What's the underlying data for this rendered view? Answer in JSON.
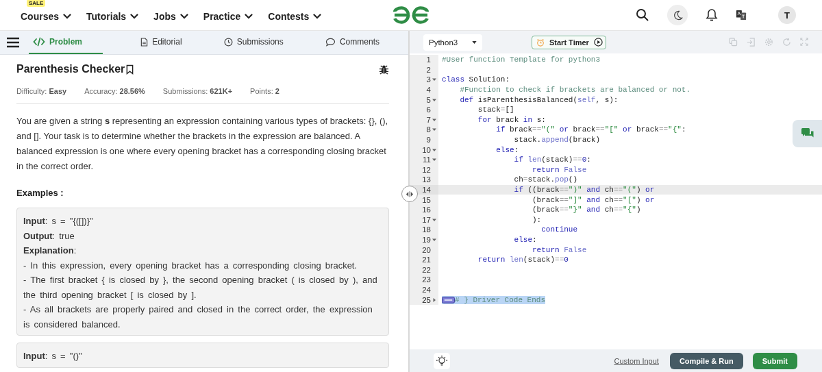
{
  "header": {
    "nav": [
      {
        "label": "Courses",
        "badge": "SALE"
      },
      {
        "label": "Tutorials"
      },
      {
        "label": "Jobs"
      },
      {
        "label": "Practice"
      },
      {
        "label": "Contests"
      }
    ],
    "avatar": "T"
  },
  "problem_tabs": [
    {
      "label": "Problem",
      "selected": true
    },
    {
      "label": "Editorial",
      "selected": false
    },
    {
      "label": "Submissions",
      "selected": false
    },
    {
      "label": "Comments",
      "selected": false
    }
  ],
  "problem": {
    "title": "Parenthesis Checker",
    "meta": [
      {
        "label": "Difficulty:",
        "value": "Easy"
      },
      {
        "label": "Accuracy:",
        "value": "28.56%"
      },
      {
        "label": "Submissions:",
        "value": "621K+"
      },
      {
        "label": "Points:",
        "value": "2"
      }
    ],
    "description": "You are given a string **s** representing an expression containing various types of brackets: {}, (), and []. Your task is to determine whether the brackets in the expression are balanced. A balanced expression is one where every opening bracket has a corresponding closing bracket in the correct order.",
    "examples_heading": "Examples :",
    "examples": [
      {
        "lines": [
          "**Input**: s = \"{([])}\"",
          "**Output**: true",
          "**Explanation**:",
          "- In this expression, every opening bracket has a corresponding closing bracket.",
          "- The first bracket { is closed by }, the second opening bracket ( is closed by ), and the third opening bracket [ is closed by ].",
          "- As all brackets are properly paired and closed in the correct order, the expression is considered balanced."
        ]
      },
      {
        "lines": [
          "**Input**: s = \"()\""
        ]
      }
    ]
  },
  "editor": {
    "language": "Python3",
    "timer_button": "Start Timer",
    "lines": [
      {
        "number": "1",
        "highlighted": false,
        "selected": false,
        "tokens": [
          {
            "kind": "comment",
            "text": "#User function Template for python3"
          }
        ]
      },
      {
        "number": "2",
        "highlighted": false,
        "selected": false
      },
      {
        "number": "3",
        "expanded": true,
        "highlighted": false,
        "selected": false,
        "tokens": [
          {
            "kind": "keyword",
            "text": "class"
          },
          {
            "kind": "plain",
            "text": " Solution:"
          }
        ]
      },
      {
        "number": "4",
        "highlighted": false,
        "selected": false,
        "tokens": [
          {
            "kind": "comment",
            "text": "    #Function to check if brackets are balanced or not."
          }
        ]
      },
      {
        "number": "5",
        "expanded": true,
        "highlighted": false,
        "selected": false,
        "tokens": [
          {
            "kind": "keyword",
            "text": "    def"
          },
          {
            "kind": "plain",
            "text": " isParenthesisBalanced("
          },
          {
            "kind": "builtin",
            "text": "self"
          },
          {
            "kind": "plain",
            "text": ", s):"
          }
        ]
      },
      {
        "number": "6",
        "highlighted": false,
        "selected": false,
        "tokens": [
          {
            "kind": "plain",
            "text": "        stack"
          },
          {
            "kind": "operator",
            "text": "="
          },
          {
            "kind": "plain",
            "text": "[]"
          }
        ]
      },
      {
        "number": "7",
        "expanded": true,
        "highlighted": false,
        "selected": false,
        "tokens": [
          {
            "kind": "keyword",
            "text": "        for"
          },
          {
            "kind": "plain",
            "text": " brack "
          },
          {
            "kind": "keyword",
            "text": "in"
          },
          {
            "kind": "plain",
            "text": " s:"
          }
        ]
      },
      {
        "number": "8",
        "expanded": true,
        "highlighted": false,
        "selected": false,
        "tokens": [
          {
            "kind": "keyword",
            "text": "            if"
          },
          {
            "kind": "plain",
            "text": " brack"
          },
          {
            "kind": "operator",
            "text": "=="
          },
          {
            "kind": "string",
            "text": "\"(\""
          },
          {
            "kind": "keyword",
            "text": " or"
          },
          {
            "kind": "plain",
            "text": " brack"
          },
          {
            "kind": "operator",
            "text": "=="
          },
          {
            "kind": "string",
            "text": "\"[\""
          },
          {
            "kind": "keyword",
            "text": " or"
          },
          {
            "kind": "plain",
            "text": " brack"
          },
          {
            "kind": "operator",
            "text": "=="
          },
          {
            "kind": "string",
            "text": "\"{\""
          },
          {
            "kind": "plain",
            "text": ":"
          }
        ]
      },
      {
        "number": "9",
        "highlighted": false,
        "selected": false,
        "tokens": [
          {
            "kind": "plain",
            "text": "                stack."
          },
          {
            "kind": "builtin",
            "text": "append"
          },
          {
            "kind": "plain",
            "text": "(brack)"
          }
        ]
      },
      {
        "number": "10",
        "expanded": true,
        "highlighted": false,
        "selected": false,
        "tokens": [
          {
            "kind": "keyword",
            "text": "            else"
          },
          {
            "kind": "plain",
            "text": ":"
          }
        ]
      },
      {
        "number": "11",
        "expanded": true,
        "highlighted": false,
        "selected": false,
        "tokens": [
          {
            "kind": "keyword",
            "text": "                if"
          },
          {
            "kind": "builtin",
            "text": " len"
          },
          {
            "kind": "plain",
            "text": "(stack)"
          },
          {
            "kind": "operator",
            "text": "=="
          },
          {
            "kind": "number",
            "text": "0"
          },
          {
            "kind": "plain",
            "text": ":"
          }
        ]
      },
      {
        "number": "12",
        "highlighted": false,
        "selected": false,
        "tokens": [
          {
            "kind": "keyword",
            "text": "                    return"
          },
          {
            "kind": "builtin",
            "text": " False"
          }
        ]
      },
      {
        "number": "13",
        "highlighted": false,
        "selected": false,
        "tokens": [
          {
            "kind": "plain",
            "text": "                ch"
          },
          {
            "kind": "operator",
            "text": "="
          },
          {
            "kind": "plain",
            "text": "stack."
          },
          {
            "kind": "builtin",
            "text": "pop"
          },
          {
            "kind": "plain",
            "text": "()"
          }
        ]
      },
      {
        "number": "14",
        "highlighted": true,
        "selected": false,
        "tokens": [
          {
            "kind": "keyword",
            "text": "                if"
          },
          {
            "kind": "plain",
            "text": " ((brack"
          },
          {
            "kind": "operator",
            "text": "=="
          },
          {
            "kind": "string",
            "text": "\")\""
          },
          {
            "kind": "keyword",
            "text": " and"
          },
          {
            "kind": "plain",
            "text": " ch"
          },
          {
            "kind": "operator",
            "text": "=="
          },
          {
            "kind": "string",
            "text": "\"(\""
          },
          {
            "kind": "plain",
            "text": ")"
          },
          {
            "kind": "keyword",
            "text": " or"
          }
        ]
      },
      {
        "number": "15",
        "highlighted": false,
        "selected": false,
        "tokens": [
          {
            "kind": "plain",
            "text": "                    (brack"
          },
          {
            "kind": "operator",
            "text": "=="
          },
          {
            "kind": "string",
            "text": "\"]\""
          },
          {
            "kind": "keyword",
            "text": " and"
          },
          {
            "kind": "plain",
            "text": " ch"
          },
          {
            "kind": "operator",
            "text": "=="
          },
          {
            "kind": "string",
            "text": "\"[\""
          },
          {
            "kind": "plain",
            "text": ")"
          },
          {
            "kind": "keyword",
            "text": " or"
          }
        ]
      },
      {
        "number": "16",
        "highlighted": false,
        "selected": false,
        "tokens": [
          {
            "kind": "plain",
            "text": "                    (brack"
          },
          {
            "kind": "operator",
            "text": "=="
          },
          {
            "kind": "string",
            "text": "\"}\""
          },
          {
            "kind": "keyword",
            "text": " and"
          },
          {
            "kind": "plain",
            "text": " ch"
          },
          {
            "kind": "operator",
            "text": "=="
          },
          {
            "kind": "string",
            "text": "\"{\""
          },
          {
            "kind": "plain",
            "text": ")"
          }
        ]
      },
      {
        "number": "17",
        "expanded": true,
        "highlighted": false,
        "selected": false,
        "tokens": [
          {
            "kind": "plain",
            "text": "                    ):"
          }
        ]
      },
      {
        "number": "18",
        "highlighted": false,
        "selected": false,
        "tokens": [
          {
            "kind": "keyword",
            "text": "                      continue"
          }
        ]
      },
      {
        "number": "19",
        "expanded": true,
        "highlighted": false,
        "selected": false,
        "tokens": [
          {
            "kind": "keyword",
            "text": "                else"
          },
          {
            "kind": "plain",
            "text": ":"
          }
        ]
      },
      {
        "number": "20",
        "highlighted": false,
        "selected": false,
        "tokens": [
          {
            "kind": "keyword",
            "text": "                    return"
          },
          {
            "kind": "builtin",
            "text": " False"
          }
        ]
      },
      {
        "number": "21",
        "highlighted": false,
        "selected": false,
        "tokens": [
          {
            "kind": "keyword",
            "text": "        return"
          },
          {
            "kind": "builtin",
            "text": " len"
          },
          {
            "kind": "plain",
            "text": "(stack)"
          },
          {
            "kind": "operator",
            "text": "=="
          },
          {
            "kind": "number",
            "text": "0"
          }
        ]
      },
      {
        "number": "22",
        "highlighted": false,
        "selected": false
      },
      {
        "number": "23",
        "highlighted": false,
        "selected": false
      },
      {
        "number": "24",
        "highlighted": false,
        "selected": false
      },
      {
        "number": "25",
        "expanded": false,
        "highlighted": false,
        "selected": true,
        "tokens": [
          {
            "kind": "comment",
            "text": "# } Driver Code Ends"
          }
        ]
      }
    ]
  },
  "footer": {
    "custom_input": "Custom Input",
    "run_button": "Compile & Run",
    "submit_button": "Submit"
  }
}
